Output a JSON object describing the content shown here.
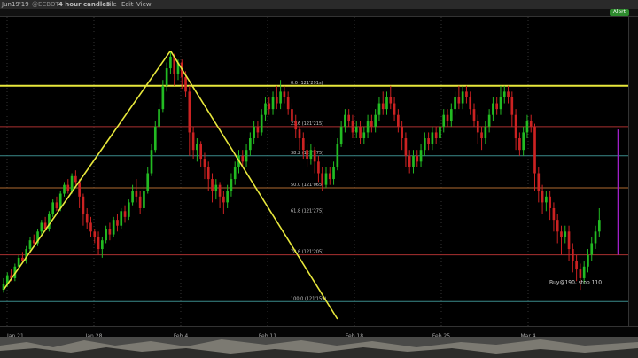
{
  "window": {
    "symbol": "Jun19'19",
    "exchange": "@ECBOT",
    "interval": "4 hour candles",
    "menu": [
      "File",
      "Edit",
      "View"
    ],
    "alert_label": "Alert"
  },
  "annotation": {
    "text": "Buy@190, stop 110"
  },
  "colors": {
    "background": "#000000",
    "up": "#22bb22",
    "down": "#cc2222",
    "resistance": "#e8e83c",
    "trendline": "#e8e83c",
    "fib_red": "#aa3030",
    "fib_teal": "#3a8a8a",
    "fib_orange": "#b06a30",
    "marker": "#a020c8"
  },
  "chart_data": {
    "type": "candlestick",
    "x_ticks": [
      "Jan 21",
      "Jan 28",
      "Feb 4",
      "Feb 11",
      "Feb 18",
      "Feb 25",
      "Mar 4"
    ],
    "y_range": [
      0,
      100
    ],
    "resistance_level": 80,
    "fib_levels": [
      {
        "label": "0.0 (121'291s)",
        "value": 80,
        "color": "yellow"
      },
      {
        "label": "23.6 (121'215)",
        "value": 66,
        "color": "red"
      },
      {
        "label": "38.2 (121'175)",
        "value": 56,
        "color": "teal"
      },
      {
        "label": "50.0 (121'065)",
        "value": 45,
        "color": "orange"
      },
      {
        "label": "61.8 (121'275)",
        "value": 36,
        "color": "teal"
      },
      {
        "label": "78.6 (121'205)",
        "value": 22,
        "color": "red"
      },
      {
        "label": "100.0 (121'155)",
        "value": 6,
        "color": "teal"
      }
    ],
    "trendlines": [
      {
        "from": [
          0,
          10
        ],
        "to": [
          44,
          92
        ]
      },
      {
        "from": [
          44,
          92
        ],
        "to": [
          88,
          0
        ]
      }
    ],
    "marker_bar": {
      "x": 162,
      "low": 22,
      "high": 65
    },
    "candles": [
      [
        0,
        10,
        12,
        9,
        14
      ],
      [
        1,
        12,
        15,
        11,
        16
      ],
      [
        2,
        15,
        14,
        13,
        17
      ],
      [
        3,
        14,
        18,
        13,
        19
      ],
      [
        4,
        18,
        21,
        17,
        22
      ],
      [
        5,
        21,
        20,
        19,
        23
      ],
      [
        6,
        20,
        24,
        19,
        25
      ],
      [
        7,
        24,
        27,
        23,
        28
      ],
      [
        8,
        27,
        26,
        25,
        29
      ],
      [
        9,
        26,
        30,
        25,
        31
      ],
      [
        10,
        30,
        33,
        29,
        34
      ],
      [
        11,
        33,
        31,
        30,
        35
      ],
      [
        12,
        31,
        36,
        30,
        37
      ],
      [
        13,
        36,
        40,
        35,
        41
      ],
      [
        14,
        40,
        38,
        37,
        42
      ],
      [
        15,
        38,
        43,
        37,
        44
      ],
      [
        16,
        43,
        46,
        42,
        47
      ],
      [
        17,
        46,
        44,
        43,
        48
      ],
      [
        18,
        44,
        49,
        43,
        50
      ],
      [
        19,
        49,
        47,
        46,
        51
      ],
      [
        20,
        47,
        42,
        38,
        48
      ],
      [
        21,
        42,
        36,
        32,
        43
      ],
      [
        22,
        36,
        33,
        31,
        38
      ],
      [
        23,
        33,
        30,
        28,
        35
      ],
      [
        24,
        30,
        28,
        26,
        31
      ],
      [
        25,
        28,
        24,
        22,
        30
      ],
      [
        26,
        24,
        27,
        21,
        28
      ],
      [
        27,
        27,
        31,
        26,
        32
      ],
      [
        28,
        31,
        29,
        27,
        33
      ],
      [
        29,
        29,
        34,
        28,
        35
      ],
      [
        30,
        34,
        32,
        30,
        36
      ],
      [
        31,
        32,
        37,
        31,
        38
      ],
      [
        32,
        37,
        35,
        33,
        39
      ],
      [
        33,
        35,
        40,
        34,
        41
      ],
      [
        34,
        40,
        44,
        39,
        46
      ],
      [
        35,
        44,
        42,
        40,
        48
      ],
      [
        36,
        42,
        38,
        36,
        44
      ],
      [
        37,
        38,
        44,
        37,
        46
      ],
      [
        38,
        44,
        50,
        43,
        52
      ],
      [
        39,
        50,
        58,
        49,
        60
      ],
      [
        40,
        58,
        66,
        57,
        68
      ],
      [
        41,
        66,
        72,
        65,
        74
      ],
      [
        42,
        72,
        80,
        71,
        82
      ],
      [
        43,
        80,
        86,
        78,
        88
      ],
      [
        44,
        86,
        90,
        84,
        92
      ],
      [
        45,
        90,
        84,
        80,
        91
      ],
      [
        46,
        84,
        88,
        82,
        89
      ],
      [
        47,
        88,
        83,
        79,
        89
      ],
      [
        48,
        83,
        78,
        76,
        85
      ],
      [
        49,
        78,
        64,
        56,
        80
      ],
      [
        50,
        64,
        58,
        55,
        66
      ],
      [
        51,
        58,
        60,
        54,
        62
      ],
      [
        52,
        60,
        55,
        52,
        61
      ],
      [
        53,
        55,
        52,
        48,
        57
      ],
      [
        54,
        52,
        48,
        44,
        54
      ],
      [
        55,
        48,
        44,
        40,
        50
      ],
      [
        56,
        44,
        46,
        41,
        48
      ],
      [
        57,
        46,
        42,
        38,
        47
      ],
      [
        58,
        42,
        40,
        36,
        44
      ],
      [
        59,
        40,
        44,
        38,
        46
      ],
      [
        60,
        44,
        48,
        42,
        50
      ],
      [
        61,
        48,
        52,
        46,
        54
      ],
      [
        62,
        52,
        56,
        50,
        58
      ],
      [
        63,
        56,
        54,
        52,
        58
      ],
      [
        64,
        54,
        58,
        52,
        60
      ],
      [
        65,
        58,
        62,
        56,
        64
      ],
      [
        66,
        62,
        66,
        60,
        68
      ],
      [
        67,
        66,
        64,
        62,
        68
      ],
      [
        68,
        64,
        70,
        63,
        72
      ],
      [
        69,
        70,
        74,
        68,
        76
      ],
      [
        70,
        74,
        72,
        70,
        76
      ],
      [
        71,
        72,
        76,
        70,
        78
      ],
      [
        72,
        76,
        74,
        72,
        80
      ],
      [
        73,
        74,
        78,
        72,
        82
      ],
      [
        74,
        78,
        76,
        74,
        80
      ],
      [
        75,
        76,
        72,
        70,
        78
      ],
      [
        76,
        72,
        68,
        66,
        74
      ],
      [
        77,
        68,
        65,
        62,
        70
      ],
      [
        78,
        65,
        62,
        58,
        66
      ],
      [
        79,
        62,
        58,
        55,
        64
      ],
      [
        80,
        58,
        55,
        52,
        60
      ],
      [
        81,
        55,
        58,
        53,
        60
      ],
      [
        82,
        58,
        54,
        50,
        59
      ],
      [
        83,
        54,
        50,
        47,
        56
      ],
      [
        84,
        50,
        46,
        44,
        52
      ],
      [
        85,
        46,
        50,
        45,
        52
      ],
      [
        86,
        50,
        48,
        46,
        52
      ],
      [
        87,
        48,
        52,
        46,
        54
      ],
      [
        88,
        52,
        60,
        51,
        62
      ],
      [
        89,
        60,
        66,
        59,
        68
      ],
      [
        90,
        66,
        70,
        64,
        72
      ],
      [
        91,
        70,
        68,
        66,
        72
      ],
      [
        92,
        68,
        64,
        62,
        70
      ],
      [
        93,
        64,
        66,
        62,
        68
      ],
      [
        94,
        66,
        62,
        60,
        68
      ],
      [
        95,
        62,
        64,
        60,
        66
      ],
      [
        96,
        64,
        68,
        62,
        70
      ],
      [
        97,
        68,
        66,
        64,
        70
      ],
      [
        98,
        66,
        70,
        64,
        72
      ],
      [
        99,
        70,
        74,
        68,
        76
      ],
      [
        100,
        74,
        72,
        70,
        78
      ],
      [
        101,
        72,
        76,
        70,
        78
      ],
      [
        102,
        76,
        74,
        72,
        80
      ],
      [
        103,
        74,
        70,
        68,
        76
      ],
      [
        104,
        70,
        66,
        64,
        72
      ],
      [
        105,
        66,
        62,
        58,
        68
      ],
      [
        106,
        62,
        56,
        52,
        64
      ],
      [
        107,
        56,
        52,
        50,
        58
      ],
      [
        108,
        52,
        56,
        50,
        58
      ],
      [
        109,
        56,
        54,
        52,
        58
      ],
      [
        110,
        54,
        58,
        52,
        60
      ],
      [
        111,
        58,
        62,
        56,
        64
      ],
      [
        112,
        62,
        60,
        58,
        64
      ],
      [
        113,
        60,
        64,
        58,
        66
      ],
      [
        114,
        64,
        62,
        60,
        66
      ],
      [
        115,
        62,
        66,
        60,
        68
      ],
      [
        116,
        66,
        70,
        64,
        72
      ],
      [
        117,
        70,
        68,
        66,
        72
      ],
      [
        118,
        68,
        72,
        66,
        74
      ],
      [
        119,
        72,
        76,
        70,
        78
      ],
      [
        120,
        76,
        74,
        72,
        80
      ],
      [
        121,
        74,
        78,
        72,
        80
      ],
      [
        122,
        78,
        76,
        74,
        80
      ],
      [
        123,
        76,
        72,
        70,
        78
      ],
      [
        124,
        72,
        68,
        66,
        74
      ],
      [
        125,
        68,
        64,
        60,
        70
      ],
      [
        126,
        64,
        62,
        58,
        66
      ],
      [
        127,
        62,
        66,
        60,
        68
      ],
      [
        128,
        66,
        70,
        64,
        72
      ],
      [
        129,
        70,
        74,
        68,
        76
      ],
      [
        130,
        74,
        72,
        70,
        76
      ],
      [
        131,
        72,
        76,
        70,
        80
      ],
      [
        132,
        76,
        78,
        74,
        80
      ],
      [
        133,
        78,
        76,
        74,
        80
      ],
      [
        134,
        76,
        70,
        66,
        78
      ],
      [
        135,
        70,
        62,
        58,
        72
      ],
      [
        136,
        62,
        58,
        56,
        64
      ],
      [
        137,
        58,
        64,
        56,
        66
      ],
      [
        138,
        64,
        68,
        62,
        70
      ],
      [
        139,
        68,
        66,
        64,
        70
      ],
      [
        140,
        66,
        50,
        44,
        67
      ],
      [
        141,
        50,
        44,
        40,
        52
      ],
      [
        142,
        44,
        40,
        36,
        46
      ],
      [
        143,
        40,
        42,
        37,
        44
      ],
      [
        144,
        42,
        38,
        34,
        44
      ],
      [
        145,
        38,
        34,
        30,
        40
      ],
      [
        146,
        34,
        30,
        26,
        36
      ],
      [
        147,
        30,
        28,
        22,
        32
      ],
      [
        148,
        28,
        30,
        26,
        32
      ],
      [
        149,
        30,
        24,
        20,
        32
      ],
      [
        150,
        24,
        20,
        16,
        26
      ],
      [
        151,
        20,
        17,
        13,
        22
      ],
      [
        152,
        17,
        14,
        10,
        19
      ],
      [
        153,
        14,
        18,
        12,
        20
      ],
      [
        154,
        18,
        22,
        16,
        24
      ],
      [
        155,
        22,
        26,
        20,
        28
      ],
      [
        156,
        26,
        30,
        24,
        32
      ],
      [
        157,
        30,
        34,
        28,
        38
      ]
    ]
  }
}
